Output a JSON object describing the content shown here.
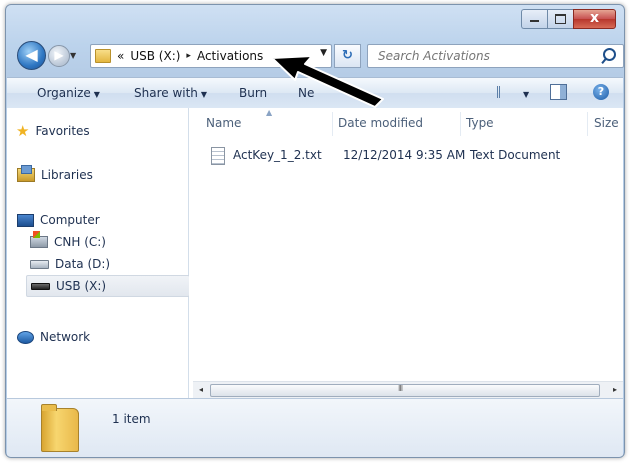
{
  "window": {
    "caption_buttons": [
      "minimize",
      "maximize",
      "close"
    ],
    "close_glyph": "x"
  },
  "nav_buttons": {
    "back_glyph": "◀",
    "forward_glyph": "▶"
  },
  "address": {
    "overflow": "«",
    "segments": [
      "USB (X:)",
      "Activations"
    ],
    "separator": "▸"
  },
  "search": {
    "placeholder": "Search Activations"
  },
  "toolbar": {
    "organize": "Organize",
    "share_with": "Share with",
    "burn": "Burn",
    "new_folder": "Ne",
    "help": "?"
  },
  "nav_pane": {
    "favorites": "Favorites",
    "libraries": "Libraries",
    "computer": "Computer",
    "drives": [
      {
        "label": "CNH (C:)",
        "icon": "system-drive-icon"
      },
      {
        "label": "Data (D:)",
        "icon": "hard-drive-icon"
      },
      {
        "label": "USB (X:)",
        "icon": "usb-drive-icon",
        "selected": true
      }
    ],
    "network": "Network"
  },
  "columns": [
    "Name",
    "Date modified",
    "Type",
    "Size"
  ],
  "files": [
    {
      "name": "ActKey_1_2.txt",
      "date_modified": "12/12/2014 9:35 AM",
      "type": "Text Document",
      "icon": "text-file-icon"
    }
  ],
  "status": {
    "item_count": "1 item"
  },
  "scroll": {
    "left_glyph": "◂",
    "right_glyph": "▸",
    "grip": "III"
  },
  "colors": {
    "chrome": "#bcd3ec",
    "close_button": "#c75050",
    "text": "#1e3050"
  }
}
